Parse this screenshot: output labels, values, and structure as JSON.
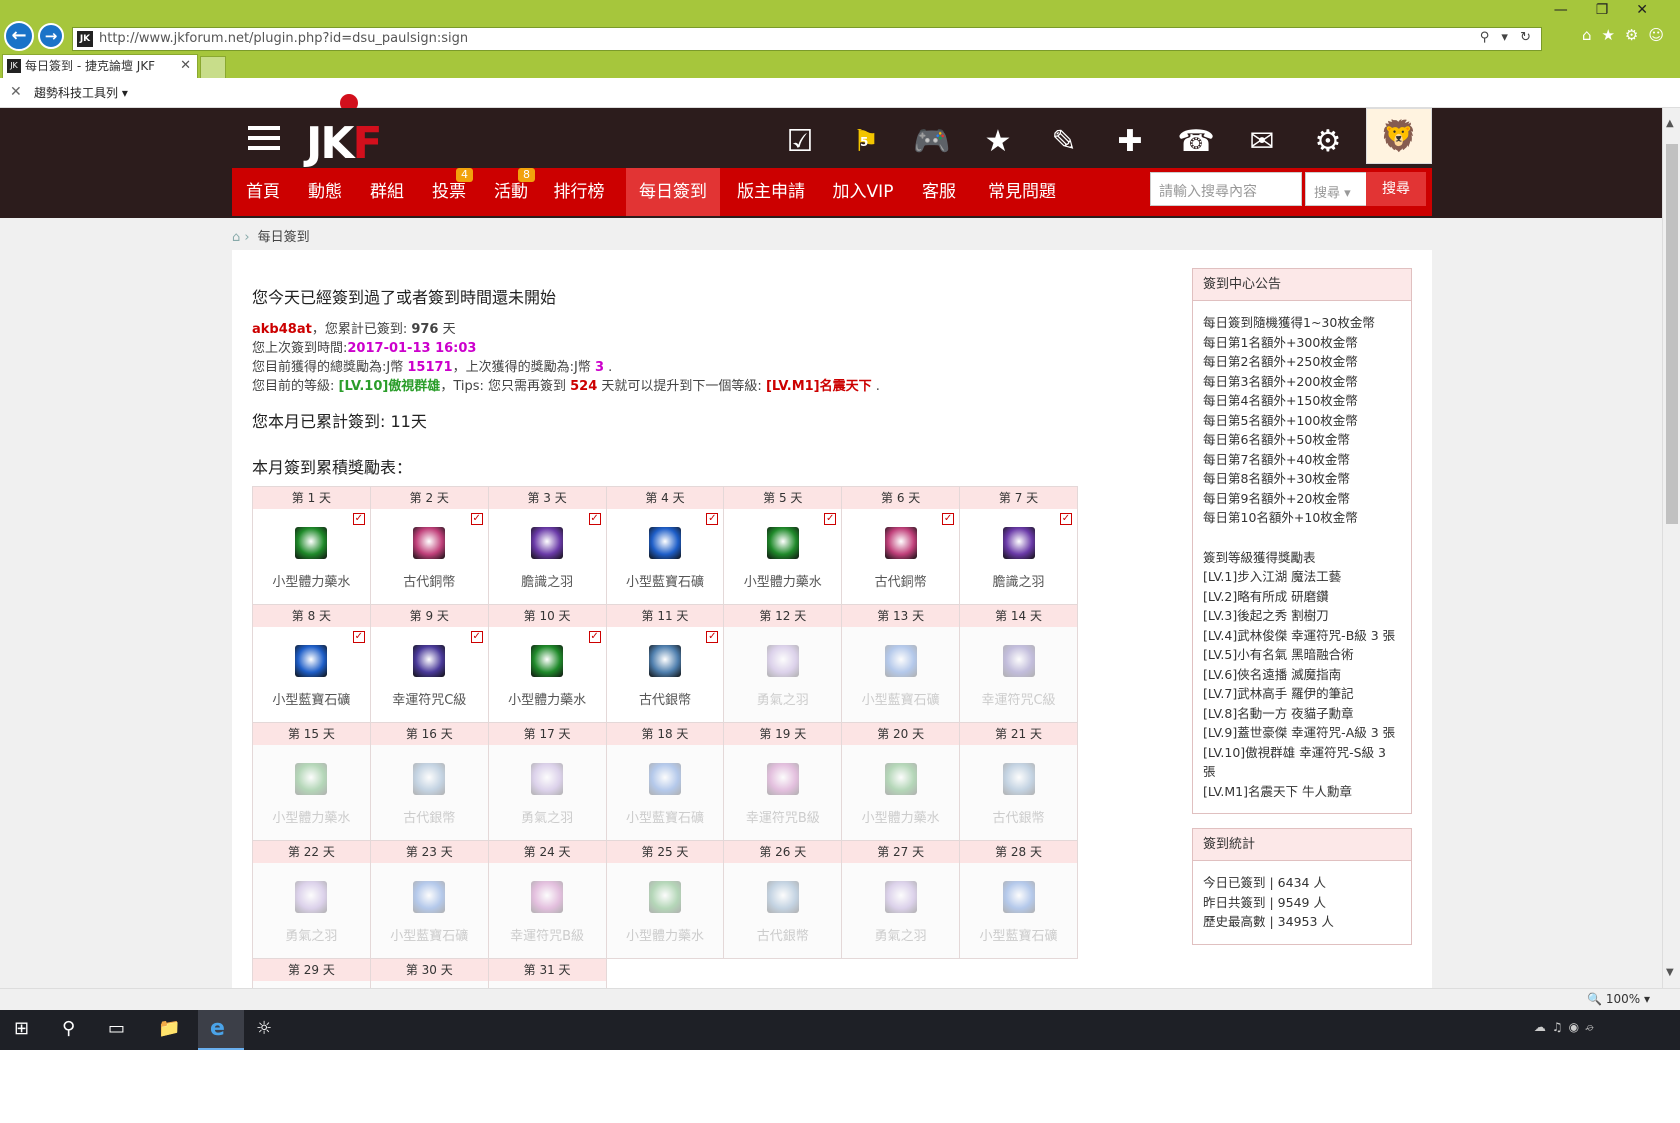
{
  "browser": {
    "url": "http://www.jkforum.net/plugin.php?id=dsu_paulsign:sign",
    "tab_title": "每日簽到 - 捷克論壇 JKF",
    "toolbar_name": "趨勢科技工具列",
    "zoom": "100%"
  },
  "header": {
    "logo": "JKF",
    "flag_badge": "5",
    "nav": [
      {
        "label": "首頁"
      },
      {
        "label": "動態"
      },
      {
        "label": "群組"
      },
      {
        "label": "投票",
        "badge": "4"
      },
      {
        "label": "活動",
        "badge": "8"
      },
      {
        "label": "排行榜"
      },
      {
        "label": "每日簽到",
        "active": true
      },
      {
        "label": "版主申請"
      },
      {
        "label": "加入VIP"
      },
      {
        "label": "客服"
      },
      {
        "label": "常見問題"
      }
    ],
    "search_placeholder": "請輸入搜尋內容",
    "search_select": "搜尋",
    "search_button": "搜尋"
  },
  "breadcrumb": "每日簽到",
  "main": {
    "title": "您今天已經簽到過了或者簽到時間還未開始",
    "username": "akb48at",
    "total_text": "，您累計已簽到: ",
    "total_days": "976",
    "day_unit": "天",
    "last_time_label": "您上次簽到時間:",
    "last_time": "2017-01-13 16:03",
    "reward_label": "您目前獲得的總獎勵為:J幣 ",
    "reward_total": "15171",
    "last_reward_label": "，上次獲得的獎勵為:J幣 ",
    "last_reward": "3",
    "level_label": "您目前的等級: ",
    "level": "[LV.10]傲視群雄",
    "tips_label": "，Tips: 您只需再簽到 ",
    "tips_days": "524",
    "tips_text": " 天就可以提升到下一個等級: ",
    "next_level": "[LV.M1]名震天下",
    "month_total": "您本月已累計簽到: 11天",
    "calendar_title": "本月簽到累積獎勵表："
  },
  "calendar": [
    {
      "day": "第 1 天",
      "item": "小型體力藥水",
      "checked": true
    },
    {
      "day": "第 2 天",
      "item": "古代銅幣",
      "checked": true
    },
    {
      "day": "第 3 天",
      "item": "膽識之羽",
      "checked": true
    },
    {
      "day": "第 4 天",
      "item": "小型藍寶石礦",
      "checked": true
    },
    {
      "day": "第 5 天",
      "item": "小型體力藥水",
      "checked": true
    },
    {
      "day": "第 6 天",
      "item": "古代銅幣",
      "checked": true
    },
    {
      "day": "第 7 天",
      "item": "膽識之羽",
      "checked": true
    },
    {
      "day": "第 8 天",
      "item": "小型藍寶石礦",
      "checked": true
    },
    {
      "day": "第 9 天",
      "item": "幸運符咒C級",
      "checked": true
    },
    {
      "day": "第 10 天",
      "item": "小型體力藥水",
      "checked": true
    },
    {
      "day": "第 11 天",
      "item": "古代銀幣",
      "checked": true
    },
    {
      "day": "第 12 天",
      "item": "勇氣之羽",
      "checked": false
    },
    {
      "day": "第 13 天",
      "item": "小型藍寶石礦",
      "checked": false
    },
    {
      "day": "第 14 天",
      "item": "幸運符咒C級",
      "checked": false
    },
    {
      "day": "第 15 天",
      "item": "小型體力藥水",
      "checked": false
    },
    {
      "day": "第 16 天",
      "item": "古代銀幣",
      "checked": false
    },
    {
      "day": "第 17 天",
      "item": "勇氣之羽",
      "checked": false
    },
    {
      "day": "第 18 天",
      "item": "小型藍寶石礦",
      "checked": false
    },
    {
      "day": "第 19 天",
      "item": "幸運符咒B級",
      "checked": false
    },
    {
      "day": "第 20 天",
      "item": "小型體力藥水",
      "checked": false
    },
    {
      "day": "第 21 天",
      "item": "古代銀幣",
      "checked": false
    },
    {
      "day": "第 22 天",
      "item": "勇氣之羽",
      "checked": false
    },
    {
      "day": "第 23 天",
      "item": "小型藍寶石礦",
      "checked": false
    },
    {
      "day": "第 24 天",
      "item": "幸運符咒B級",
      "checked": false
    },
    {
      "day": "第 25 天",
      "item": "小型體力藥水",
      "checked": false
    },
    {
      "day": "第 26 天",
      "item": "古代銀幣",
      "checked": false
    },
    {
      "day": "第 27 天",
      "item": "勇氣之羽",
      "checked": false
    },
    {
      "day": "第 28 天",
      "item": "小型藍寶石礦",
      "checked": false
    },
    {
      "day": "第 29 天",
      "item": "",
      "checked": false
    },
    {
      "day": "第 30 天",
      "item": "",
      "checked": false
    },
    {
      "day": "第 31 天",
      "item": "",
      "checked": false
    }
  ],
  "item_colors": {
    "小型體力藥水": "#1f8a2a",
    "古代銅幣": "#c0407a",
    "膽識之羽": "#6a3aa8",
    "小型藍寶石礦": "#1e5ec8",
    "幸運符咒C級": "#4a3a9a",
    "古代銀幣": "#4f7fae",
    "勇氣之羽": "#9a7ac8",
    "幸運符咒B級": "#b040a0"
  },
  "sidebar": {
    "notice_title": "簽到中心公告",
    "notice_lines": [
      "每日簽到隨機獲得1~30枚金幣",
      "每日第1名額外+300枚金幣",
      "每日第2名額外+250枚金幣",
      "每日第3名額外+200枚金幣",
      "每日第4名額外+150枚金幣",
      "每日第5名額外+100枚金幣",
      "每日第6名額外+50枚金幣",
      "每日第7名額外+40枚金幣",
      "每日第8名額外+30枚金幣",
      "每日第9名額外+20枚金幣",
      "每日第10名額外+10枚金幣"
    ],
    "level_title": "簽到等級獲得獎勵表",
    "level_lines": [
      "[LV.1]步入江湖 魔法工藝",
      "[LV.2]略有所成 研磨鑽",
      "[LV.3]後起之秀 割樹刀",
      "[LV.4]武林俊傑 幸運符咒-B級 3 張",
      "[LV.5]小有名氣 黑暗融合術",
      "[LV.6]俠名遠播 滅魔指南",
      "[LV.7]武林高手 羅伊的筆記",
      "[LV.8]名動一方 夜貓子勳章",
      "[LV.9]蓋世豪傑 幸運符咒-A級 3 張",
      "[LV.10]傲視群雄 幸運符咒-S級 3 張",
      "[LV.M1]名震天下 牛人勳章"
    ],
    "stats_title": "簽到統計",
    "stats_lines": [
      "今日已簽到 | 6434 人",
      "昨日共簽到 | 9549 人",
      "歷史最高數 | 34953 人"
    ]
  }
}
